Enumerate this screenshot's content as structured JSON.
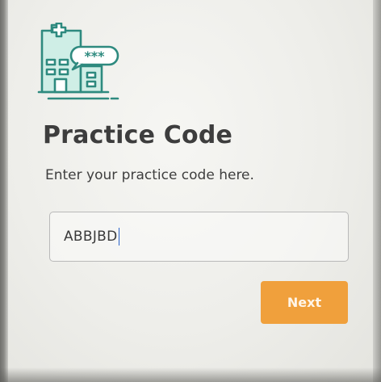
{
  "logo": {
    "icon": "hospital-building-with-password-bubble-icon",
    "bubble_text": "***",
    "stroke_color": "#2e8a7f",
    "fill_color": "#cfeee6"
  },
  "header": {
    "title": "Practice Code",
    "subtitle": "Enter your practice code here."
  },
  "form": {
    "practice_code_value": "ABBJBD"
  },
  "actions": {
    "next_label": "Next",
    "next_color": "#f0a03c"
  }
}
